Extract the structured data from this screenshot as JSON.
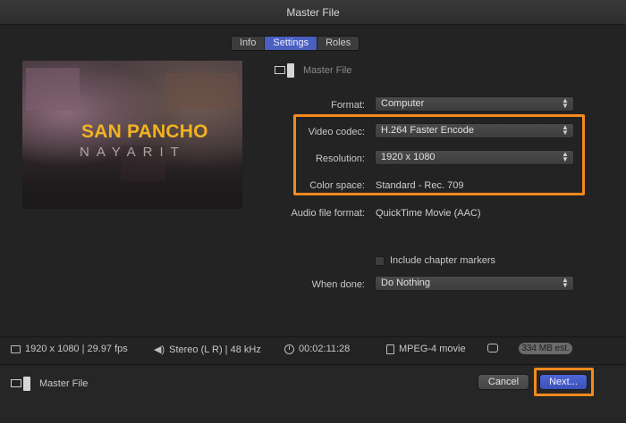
{
  "window": {
    "title": "Master File"
  },
  "tabs": [
    {
      "label": "Info",
      "active": false
    },
    {
      "label": "Settings",
      "active": true
    },
    {
      "label": "Roles",
      "active": false
    }
  ],
  "preview": {
    "title": "SAN PANCHO",
    "subtitle": "NAYARIT"
  },
  "destination": {
    "name": "Master File",
    "icon": "monitor-tower-icon"
  },
  "settings": {
    "format": {
      "label": "Format:",
      "value": "Computer"
    },
    "video_codec": {
      "label": "Video codec:",
      "value": "H.264 Faster Encode"
    },
    "resolution": {
      "label": "Resolution:",
      "value": "1920 x 1080"
    },
    "color_space": {
      "label": "Color space:",
      "value": "Standard - Rec. 709"
    },
    "audio_format": {
      "label": "Audio file format:",
      "value": "QuickTime Movie (AAC)"
    },
    "chapter_markers": {
      "label": "Include chapter markers",
      "checked": false
    },
    "when_done": {
      "label": "When done:",
      "value": "Do Nothing"
    }
  },
  "summary": {
    "video": "1920 x 1080 | 29.97 fps",
    "audio": "Stereo (L R) | 48 kHz",
    "duration": "00:02:11:28",
    "file_type": "MPEG-4 movie",
    "size": "334 MB est."
  },
  "footer": {
    "destination": "Master File",
    "cancel_label": "Cancel",
    "next_label": "Next..."
  },
  "colors": {
    "accent": "#4a5fc0",
    "highlight": "#f58a1f",
    "title_gold": "#f2b321"
  }
}
